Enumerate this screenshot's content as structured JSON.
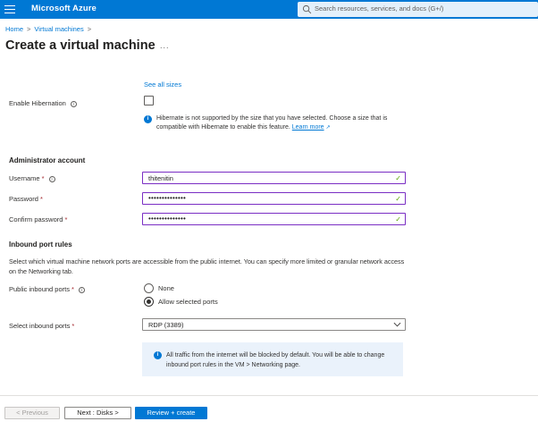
{
  "topbar": {
    "brand": "Microsoft Azure",
    "search_placeholder": "Search resources, services, and docs (G+/)"
  },
  "breadcrumb": [
    "Home",
    "Virtual machines"
  ],
  "page_title": "Create a virtual machine",
  "title_more": "...",
  "see_all_sizes": "See all sizes",
  "hibernation": {
    "label": "Enable Hibernation",
    "checked": false,
    "info_text": "Hibernate is not supported by the size that you have selected. Choose a size that is compatible with Hibernate to enable this feature.",
    "learn_more": "Learn more"
  },
  "admin": {
    "section_title": "Administrator account",
    "username_label": "Username",
    "username_value": "thitenitin",
    "password_label": "Password",
    "password_value": "••••••••••••••",
    "confirm_label": "Confirm password",
    "confirm_value": "••••••••••••••",
    "required_mark": "*"
  },
  "inbound": {
    "section_title": "Inbound port rules",
    "description": "Select which virtual machine network ports are accessible from the public internet. You can specify more limited or granular network access on the Networking tab.",
    "public_ports_label": "Public inbound ports",
    "option_none": "None",
    "option_allow": "Allow selected ports",
    "selected_option": "Allow selected ports",
    "select_ports_label": "Select inbound ports",
    "select_ports_value": "RDP (3389)",
    "traffic_info": "All traffic from the internet will be blocked by default. You will be able to change inbound port rules in the VM > Networking page."
  },
  "footer": {
    "previous": "< Previous",
    "next": "Next : Disks >",
    "review": "Review + create"
  },
  "colors": {
    "accent": "#0078d4",
    "valid_check": "#57a300",
    "focus_border": "#7a2ec4",
    "required": "#a4262c"
  }
}
